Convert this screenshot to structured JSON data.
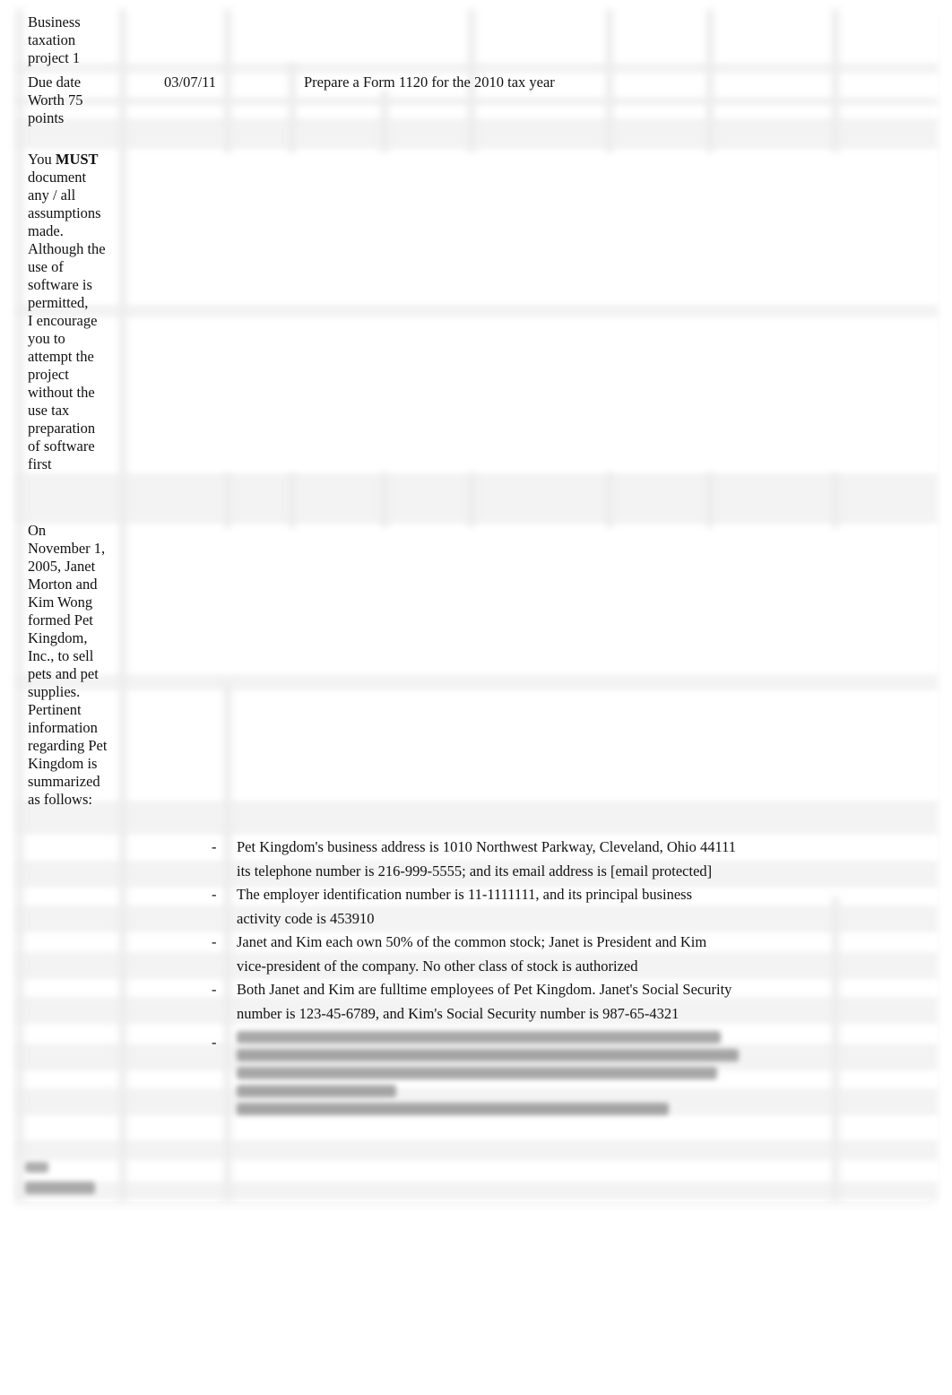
{
  "document": {
    "header": {
      "title": "Business\ntaxation\nproject 1",
      "due_label": "Due date\nWorth 75\npoints",
      "due_date": "03/07/11",
      "assignment": "Prepare a Form 1120 for the 2010 tax year"
    },
    "instructions": {
      "prefix": "You ",
      "emphasis": "MUST",
      "body": "document\nany / all\nassumptions\nmade.\nAlthough the\nuse of\nsoftware is\npermitted,\n I encourage\nyou to\nattempt the\nproject\nwithout the\nuse tax\npreparation\nof software\nfirst"
    },
    "background": {
      "text": "On\nNovember 1,\n2005, Janet\nMorton and\nKim Wong\nformed Pet\nKingdom,\nInc., to sell\npets and pet\nsupplies.\nPertinent\ninformation\nregarding Pet\nKingdom is\nsummarized\nas follows:"
    },
    "bullets": [
      {
        "marker": "-",
        "lines": [
          "Pet Kingdom's business address is 1010 Northwest Parkway, Cleveland, Ohio 44111",
          "its telephone number is 216-999-5555; and its email address is [email protected]"
        ]
      },
      {
        "marker": "-",
        "lines": [
          "The employer identification number is 11-1111111, and its principal business",
          "activity code is 453910"
        ]
      },
      {
        "marker": "-",
        "lines": [
          "Janet and Kim each own 50% of the common stock; Janet is President and Kim",
          "vice-president of the company. No other class of stock is authorized"
        ]
      },
      {
        "marker": "-",
        "lines": [
          "Both Janet and Kim are fulltime employees of Pet Kingdom. Janet's Social Security",
          "number is 123-45-6789, and Kim's Social Security number is 987-65-4321"
        ]
      },
      {
        "marker": "-",
        "obscured": true,
        "obscured_line_count": 5
      }
    ],
    "obscured_footer_cell": true
  }
}
